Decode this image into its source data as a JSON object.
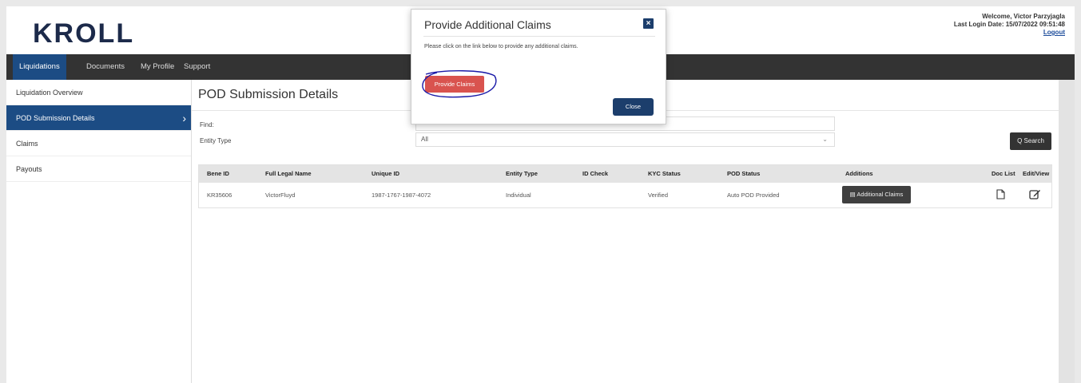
{
  "header": {
    "logo_text": "KROLL",
    "welcome": "Welcome, Victor Parzyjagla",
    "last_login": "Last Login Date: 15/07/2022 09:51:48",
    "logout": "Logout"
  },
  "nav": {
    "items": [
      {
        "label": "Liquidations"
      },
      {
        "label": "Documents"
      },
      {
        "label": "My Profile"
      },
      {
        "label": "Support"
      }
    ]
  },
  "sidebar": {
    "items": [
      {
        "label": "Liquidation Overview"
      },
      {
        "label": "POD Submission Details"
      },
      {
        "label": "Claims"
      },
      {
        "label": "Payouts"
      }
    ]
  },
  "main": {
    "title": "POD Submission Details",
    "find_label": "Find:",
    "entity_label": "Entity Type",
    "entity_value": "All",
    "search_label": "Q Search",
    "table": {
      "headers": [
        "Bene ID",
        "Full Legal Name",
        "Unique ID",
        "Entity Type",
        "ID Check",
        "KYC Status",
        "POD Status",
        "Additions",
        "Doc List",
        "Edit/View"
      ],
      "rows": [
        {
          "bene_id": "KR35606",
          "name": "VictorFluyd",
          "unique_id": "1987-1767-1987-4072",
          "entity_type": "Individual",
          "id_check": "",
          "kyc_status": "Verified",
          "pod_status": "Auto POD Provided",
          "additions": "Additional Claims"
        }
      ]
    }
  },
  "modal": {
    "title": "Provide Additional Claims",
    "close_x": "×",
    "text": "Please click on the link below to provide any additional claims.",
    "provide_button": "Provide Claims",
    "close_button": "Close",
    "annotation_color": "#1a1aa8"
  },
  "colors": {
    "nav_active": "#1c4c84",
    "navbar": "#333333",
    "danger": "#d9534f",
    "primary": "#1c3e6c"
  },
  "icons": {
    "doc": "document-icon",
    "edit": "edit-icon",
    "additional_claims": "list-icon",
    "search": "search-icon"
  }
}
